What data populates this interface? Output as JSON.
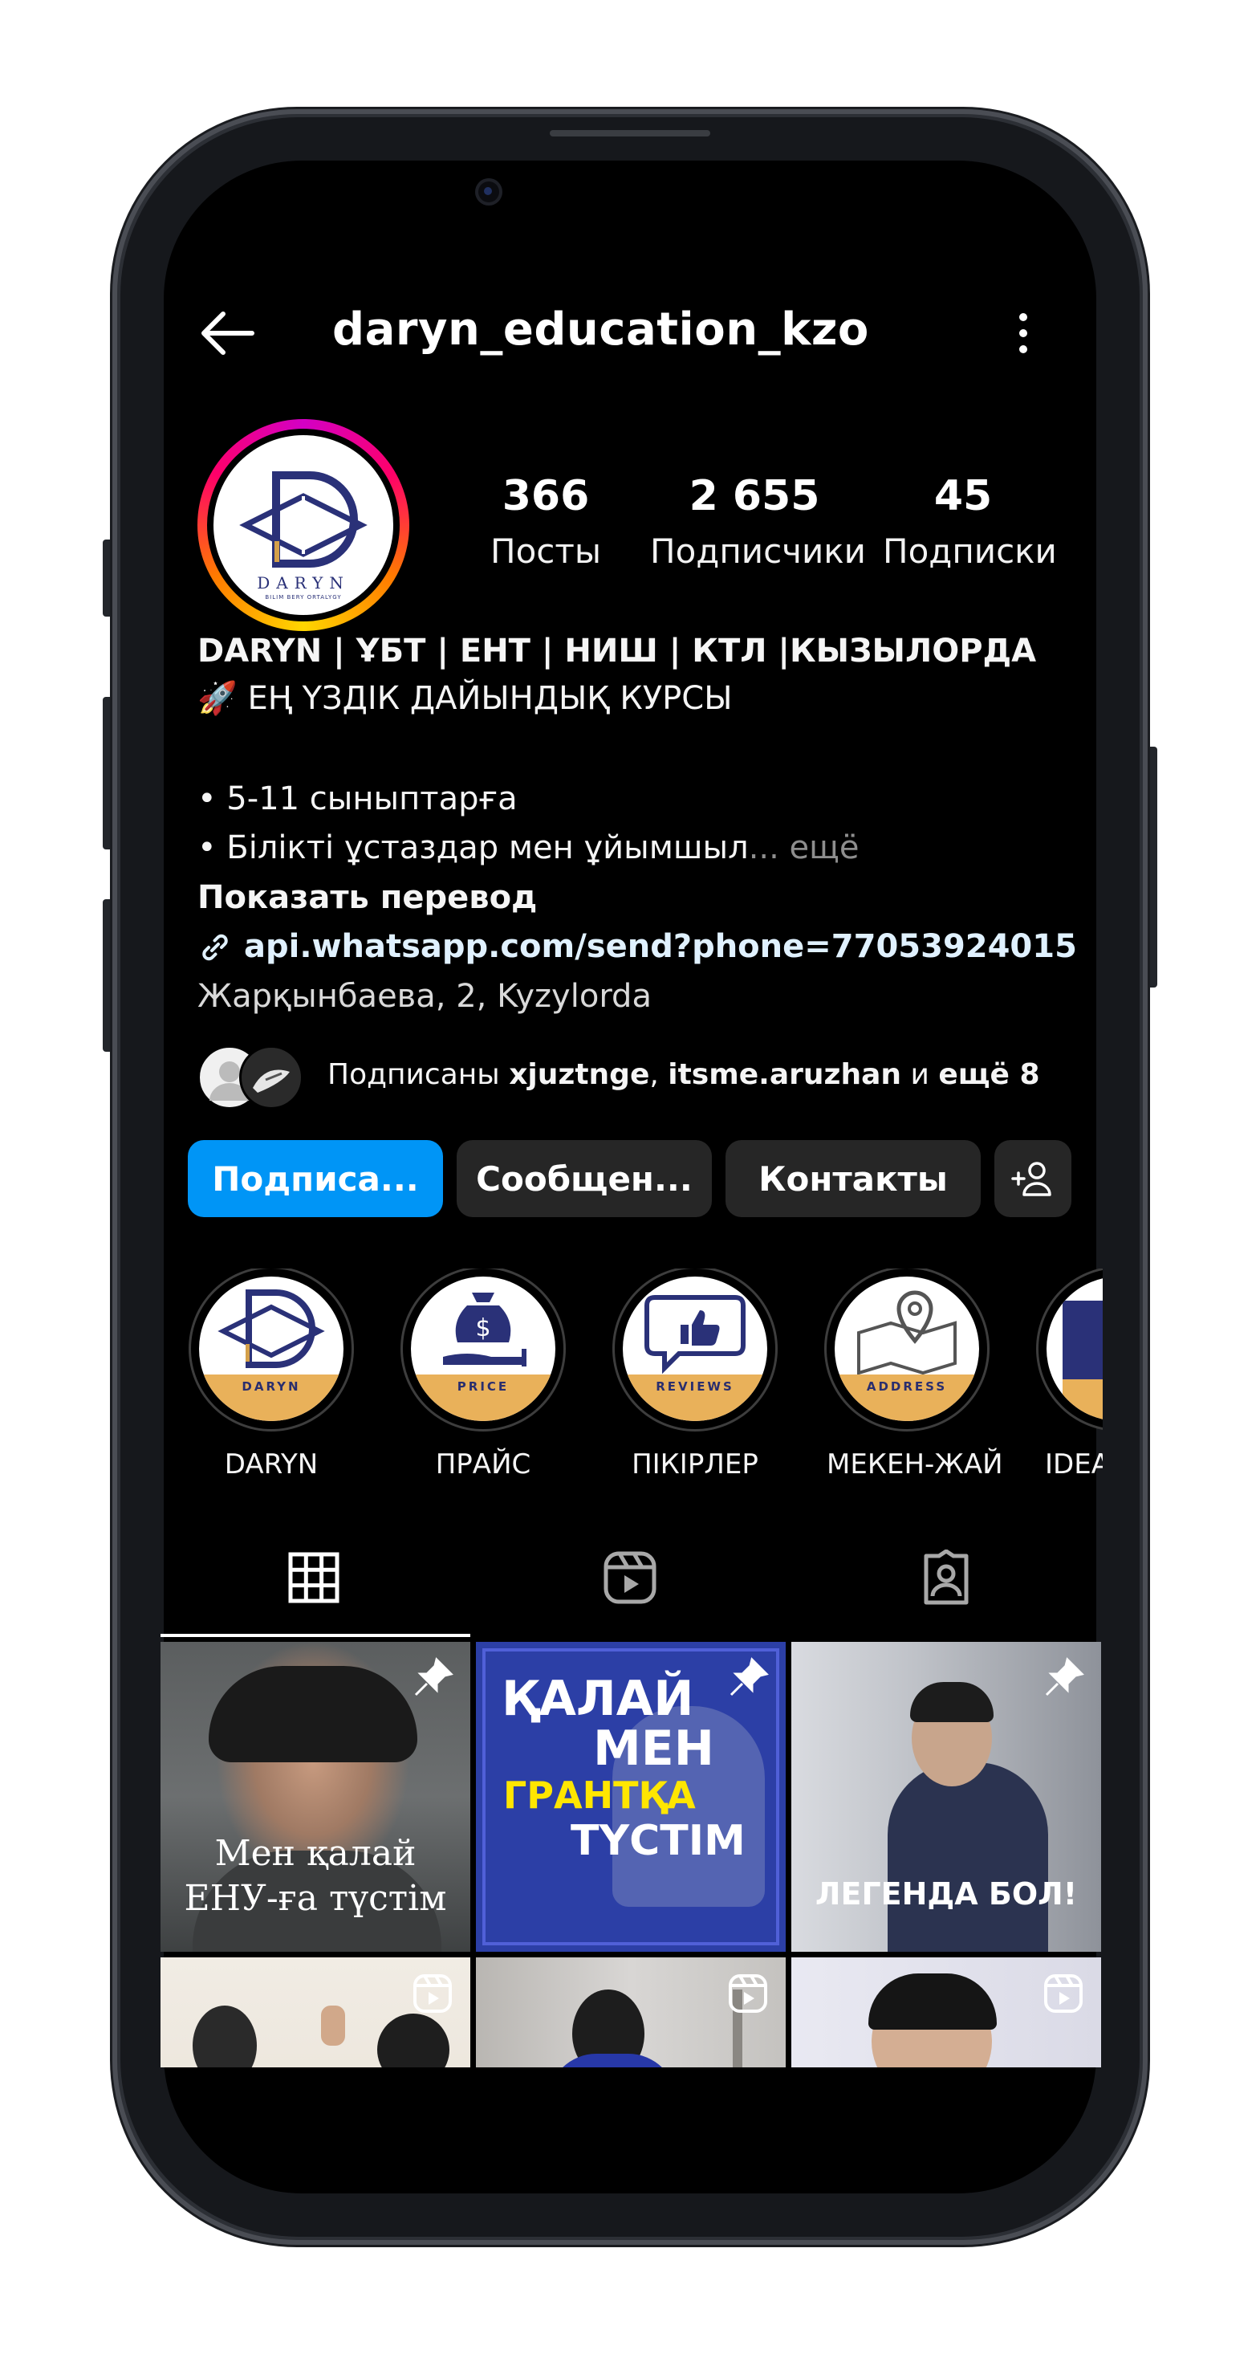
{
  "header": {
    "username": "daryn_education_kzo"
  },
  "profile": {
    "avatar_logo_text": "DARYN",
    "avatar_logo_subtext": "BILIM BERY ORTALYGY",
    "stats": [
      {
        "value": "366",
        "label": "Посты"
      },
      {
        "value": "2 655",
        "label": "Подписчики"
      },
      {
        "value": "45",
        "label": "Подписки"
      }
    ]
  },
  "bio": {
    "name_line": "DARYN | ҰБТ | ЕНТ | НИШ | КТЛ |КЫЗЫЛОРДА",
    "tagline": "🚀 ЕҢ ҮЗДІК ДАЙЫНДЫҚ КУРСЫ",
    "bullet1": "•  5-11 сыныптарға",
    "bullet2": "• Білікті ұстаздар мен ұйымшыл",
    "more": "... ещё",
    "translate": "Показать перевод",
    "link": "api.whatsapp.com/send?phone=77053924015",
    "address": "Жарқынбаева, 2, Kyzylorda"
  },
  "followed_by": {
    "prefix": "Подписаны ",
    "user1": "xjuztnge",
    "sep": ", ",
    "user2": "itsme.aruzhan",
    "mid": " и ",
    "rest": "ещё 8"
  },
  "actions": {
    "follow": "Подписа...",
    "message": "Сообщен...",
    "contacts": "Контакты"
  },
  "highlights": [
    {
      "label": "DARYN",
      "band": "DARYN"
    },
    {
      "label": "ПРАЙС",
      "band": "PRICE"
    },
    {
      "label": "ПІКІРЛЕР",
      "band": "REVIEWS"
    },
    {
      "label": "МЕКЕН-ЖАЙ",
      "band": "ADDRESS"
    },
    {
      "label": "IDEA"
    }
  ],
  "posts": {
    "post1_caption_line1": "Мен қалай",
    "post1_caption_line2": "ЕНУ-ға түстім",
    "post2_line1": "ҚАЛАЙ",
    "post2_line2": "МЕН",
    "post2_line3": "ГРАНТҚА",
    "post2_line4": "ТҮСТІМ",
    "post3_caption": "ЛЕГЕНДА БОЛ!"
  },
  "colors": {
    "accent": "#0095f6",
    "button_bg": "#262626",
    "highlight_band": "#e9b15a",
    "post2_bg": "#2c3fa6",
    "post2_yellow": "#ffe600"
  }
}
